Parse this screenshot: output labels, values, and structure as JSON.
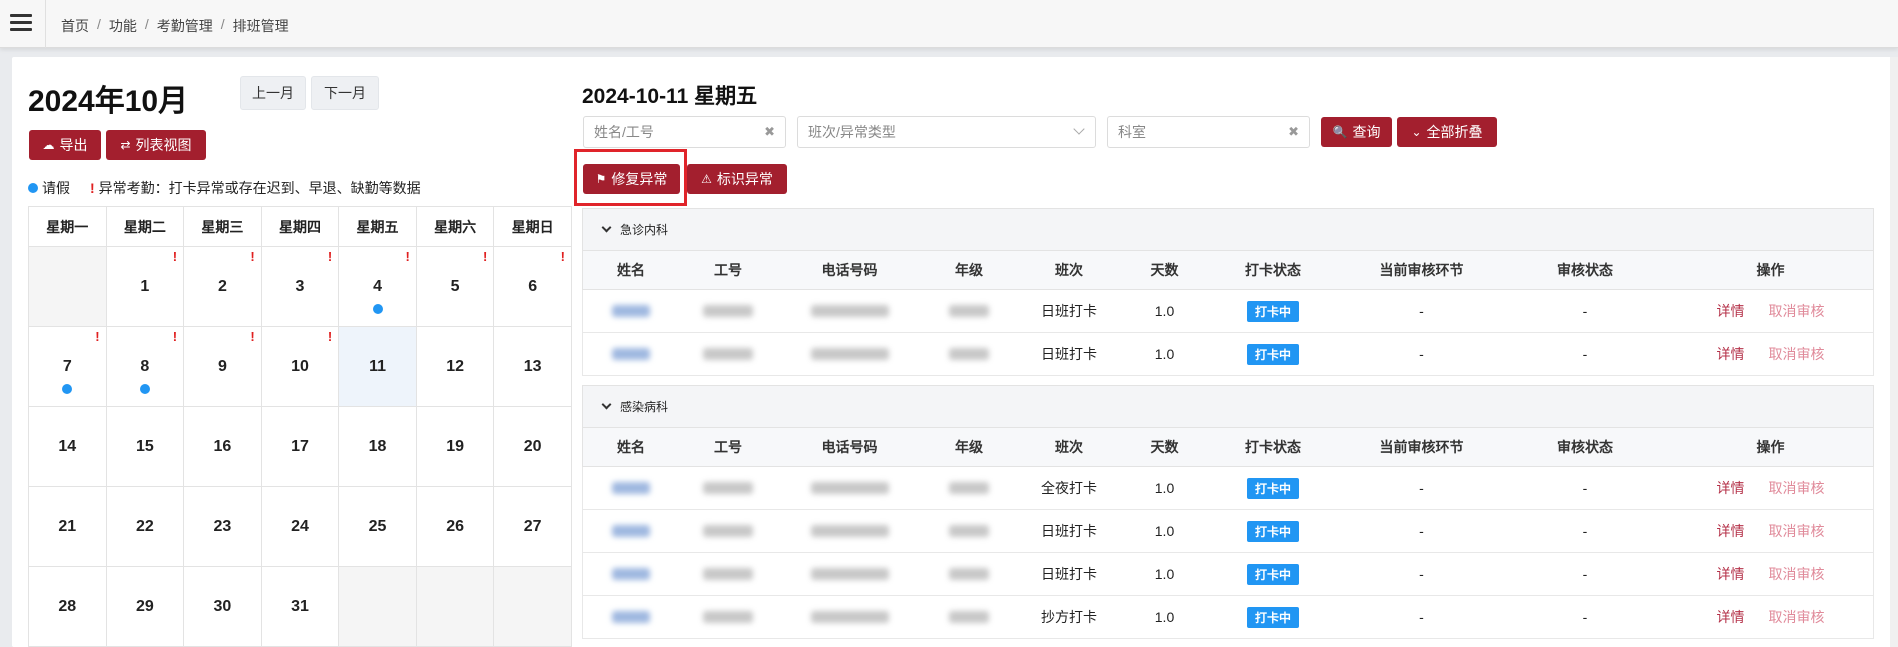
{
  "breadcrumb": [
    "首页",
    "功能",
    "考勤管理",
    "排班管理"
  ],
  "calendar": {
    "month_title": "2024年10月",
    "prev_label": "上一月",
    "next_label": "下一月",
    "export_label": "导出",
    "list_view_label": "列表视图",
    "legend_leave": "请假",
    "legend_abnormal": "异常考勤：打卡异常或存在迟到、早退、缺勤等数据",
    "weekdays": [
      "星期一",
      "星期二",
      "星期三",
      "星期四",
      "星期五",
      "星期六",
      "星期日"
    ],
    "weeks": [
      [
        {
          "d": ""
        },
        {
          "d": "1",
          "abn": true
        },
        {
          "d": "2",
          "abn": true
        },
        {
          "d": "3",
          "abn": true
        },
        {
          "d": "4",
          "abn": true,
          "leave": true
        },
        {
          "d": "5",
          "abn": true
        },
        {
          "d": "6",
          "abn": true
        }
      ],
      [
        {
          "d": "7",
          "abn": true,
          "leave": true
        },
        {
          "d": "8",
          "abn": true,
          "leave": true
        },
        {
          "d": "9",
          "abn": true
        },
        {
          "d": "10",
          "abn": true
        },
        {
          "d": "11",
          "today": true
        },
        {
          "d": "12"
        },
        {
          "d": "13"
        }
      ],
      [
        {
          "d": "14"
        },
        {
          "d": "15"
        },
        {
          "d": "16"
        },
        {
          "d": "17"
        },
        {
          "d": "18"
        },
        {
          "d": "19"
        },
        {
          "d": "20"
        }
      ],
      [
        {
          "d": "21"
        },
        {
          "d": "22"
        },
        {
          "d": "23"
        },
        {
          "d": "24"
        },
        {
          "d": "25"
        },
        {
          "d": "26"
        },
        {
          "d": "27"
        }
      ],
      [
        {
          "d": "28"
        },
        {
          "d": "29"
        },
        {
          "d": "30"
        },
        {
          "d": "31"
        },
        {
          "d": ""
        },
        {
          "d": ""
        },
        {
          "d": ""
        }
      ]
    ]
  },
  "detail": {
    "date_title": "2024-10-11 星期五",
    "name_placeholder": "姓名/工号",
    "shift_placeholder": "班次/异常类型",
    "dept_placeholder": "科室",
    "query_label": "查询",
    "collapse_label": "全部折叠",
    "repair_label": "修复异常",
    "mark_label": "标识异常",
    "columns": [
      "姓名",
      "工号",
      "电话号码",
      "年级",
      "班次",
      "天数",
      "打卡状态",
      "当前审核环节",
      "审核状态",
      "操作"
    ],
    "detail_link": "详情",
    "cancel_link": "取消审核",
    "sections": [
      {
        "name": "急诊内科",
        "rows": [
          {
            "shift": "日班打卡",
            "days": "1.0",
            "status": "打卡中",
            "step": "-",
            "audit": "-"
          },
          {
            "shift": "日班打卡",
            "days": "1.0",
            "status": "打卡中",
            "step": "-",
            "audit": "-"
          }
        ]
      },
      {
        "name": "感染病科",
        "rows": [
          {
            "shift": "全夜打卡",
            "days": "1.0",
            "status": "打卡中",
            "step": "-",
            "audit": "-"
          },
          {
            "shift": "日班打卡",
            "days": "1.0",
            "status": "打卡中",
            "step": "-",
            "audit": "-"
          },
          {
            "shift": "日班打卡",
            "days": "1.0",
            "status": "打卡中",
            "step": "-",
            "audit": "-"
          },
          {
            "shift": "抄方打卡",
            "days": "1.0",
            "status": "打卡中",
            "step": "-",
            "audit": "-"
          }
        ]
      }
    ]
  },
  "colors": {
    "accent": "#a31f2e",
    "badge": "#2196f3",
    "abnormal": "#e02020",
    "leave_dot": "#2196f3"
  }
}
